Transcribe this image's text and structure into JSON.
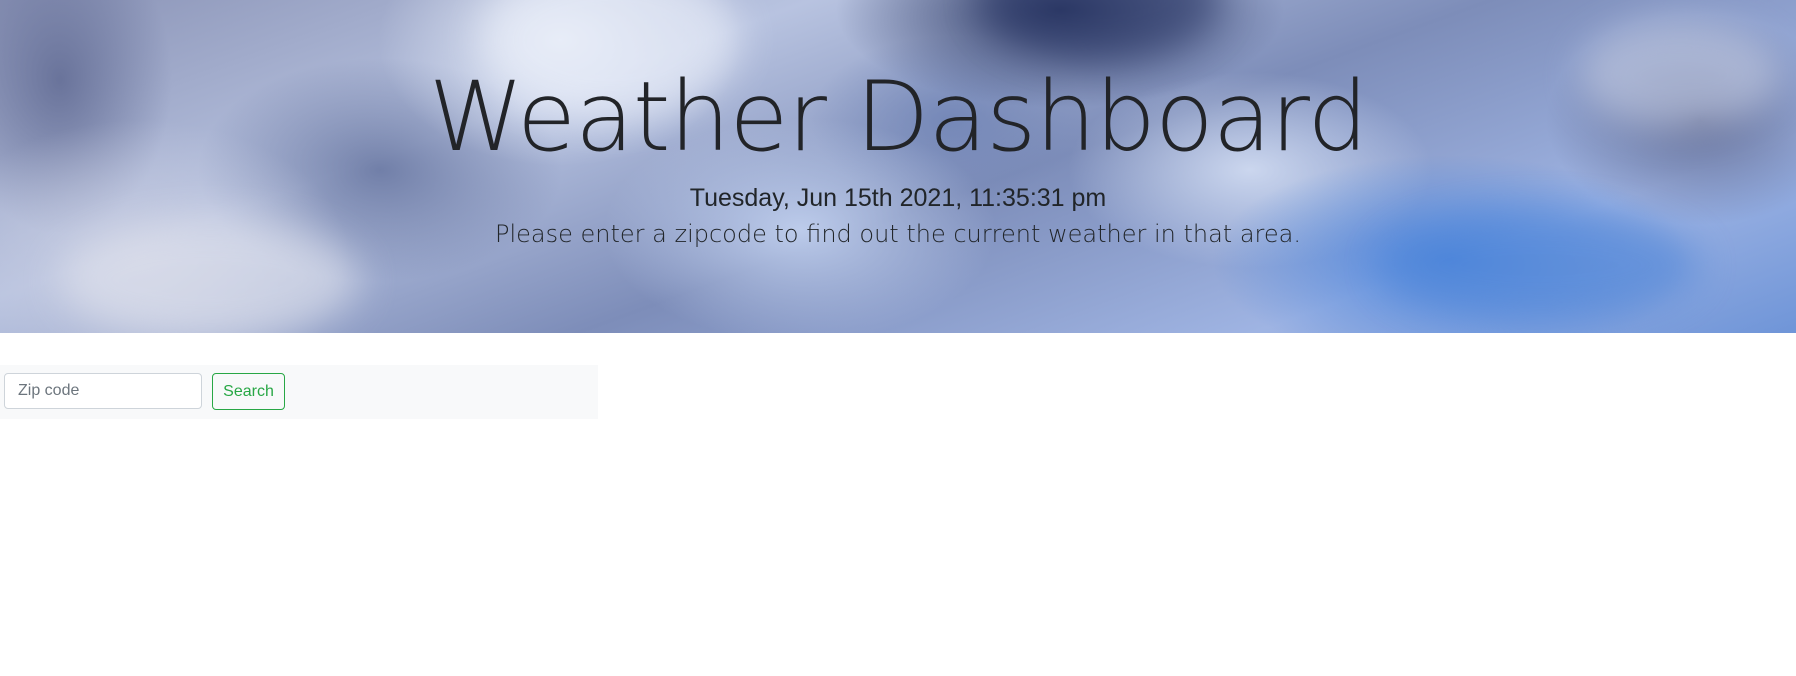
{
  "header": {
    "title": "Weather Dashboard",
    "datetime": "Tuesday, Jun 15th 2021, 11:35:31 pm",
    "subtitle": "Please enter a zipcode to find out the current weather in that area."
  },
  "search": {
    "placeholder": "Zip code",
    "value": "",
    "button_label": "Search"
  },
  "colors": {
    "accent": "#28a745",
    "text": "#212529",
    "search_bar_background": "#f8f9fa"
  }
}
